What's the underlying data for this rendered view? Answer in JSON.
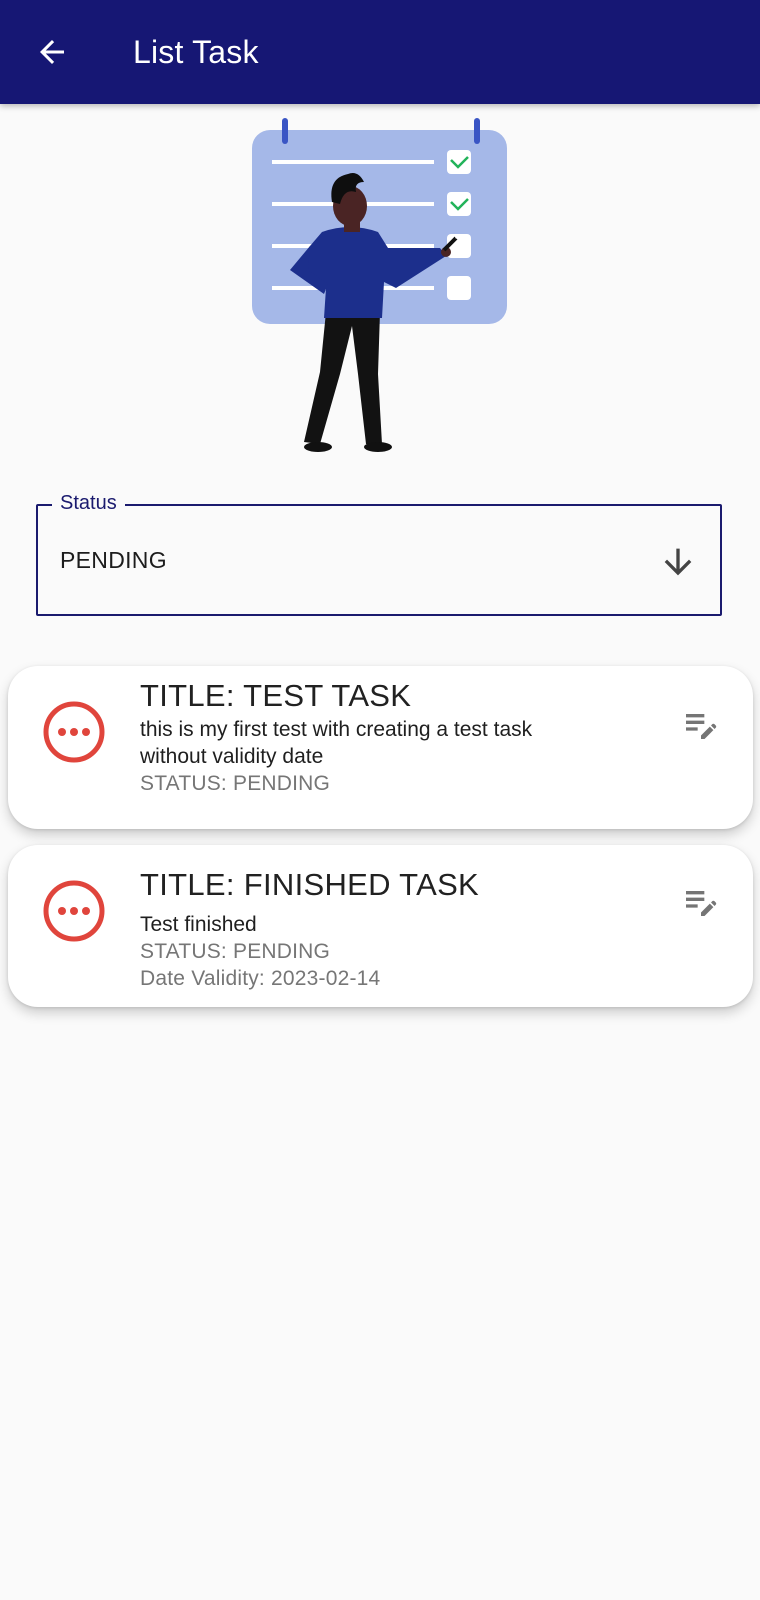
{
  "appbar": {
    "title": "List Task",
    "background": "#161774",
    "back_icon": "arrow-back-icon"
  },
  "illustration": {
    "description_icon": "task-checklist-illustration"
  },
  "status_filter": {
    "label": "Status",
    "value": "PENDING",
    "icon": "arrow-down-icon",
    "border_color": "#1a1a6e"
  },
  "tasks": [
    {
      "title": "TITLE: TEST TASK",
      "description_line1": "this is my first test with creating a test task",
      "description_line2": "without validity date",
      "status": "STATUS: PENDING",
      "status_icon": "pending-dots-icon",
      "edit_icon": "edit-note-icon"
    },
    {
      "title": "TITLE: FINISHED TASK",
      "description": "Test finished",
      "status": "STATUS: PENDING",
      "date_validity": "Date Validity: 2023-02-14",
      "status_icon": "pending-dots-icon",
      "edit_icon": "edit-note-icon"
    }
  ],
  "colors": {
    "pending_red": "#e0453c",
    "meta_grey": "#767676",
    "icon_grey": "#757575"
  }
}
